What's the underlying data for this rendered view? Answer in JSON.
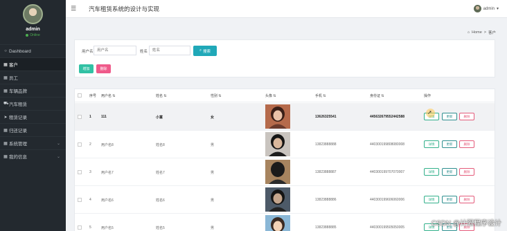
{
  "sidebar": {
    "username": "admin",
    "status": "Online",
    "items": [
      {
        "label": "Dashboard",
        "icon": "circle-icon"
      },
      {
        "label": "客户",
        "icon": "grid-icon",
        "active": true
      },
      {
        "label": "员工",
        "icon": "grid-icon"
      },
      {
        "label": "车辆品牌",
        "icon": "grid-icon"
      },
      {
        "label": "汽车租赁",
        "icon": "car-icon"
      },
      {
        "label": "租赁记录",
        "icon": "paper-plane-icon"
      },
      {
        "label": "归还记录",
        "icon": "grid-icon"
      },
      {
        "label": "系统管理",
        "icon": "grid-icon",
        "chevron": true
      },
      {
        "label": "我的信息",
        "icon": "grid-icon",
        "chevron": true
      }
    ]
  },
  "header": {
    "title": "汽车租赁系统的设计与实现",
    "user": "admin"
  },
  "breadcrumb": {
    "home": "Home",
    "sep": ">",
    "current": "客户"
  },
  "search": {
    "username_label": "用户名",
    "username_placeholder": "用户名",
    "name_label": "姓名",
    "name_placeholder": "姓名",
    "search_button": "搜索"
  },
  "actions": {
    "add": "增加",
    "delete": "删除"
  },
  "table": {
    "columns": [
      "序号",
      "用户名",
      "姓名",
      "性别",
      "头像",
      "手机",
      "身份证",
      "操作"
    ],
    "rows": [
      {
        "index": "1",
        "username": "111",
        "name": "小富",
        "gender": "女",
        "phone": "13626325541",
        "id_card": "445632679552442588",
        "photo": "photo-1"
      },
      {
        "index": "2",
        "username": "用户名8",
        "name": "姓名8",
        "gender": "男",
        "phone": "13823888888",
        "id_card": "440300199808080008",
        "photo": "photo-2"
      },
      {
        "index": "3",
        "username": "用户名7",
        "name": "姓名7",
        "gender": "男",
        "phone": "13823888887",
        "id_card": "440300199707070007",
        "photo": "photo-3"
      },
      {
        "index": "4",
        "username": "用户名6",
        "name": "姓名6",
        "gender": "男",
        "phone": "13823888886",
        "id_card": "440300199606060006",
        "photo": "photo-4"
      },
      {
        "index": "5",
        "username": "用户名5",
        "name": "姓名5",
        "gender": "男",
        "phone": "13823888885",
        "id_card": "440300199505050005",
        "photo": "photo-5"
      }
    ],
    "ops": {
      "detail": "详情",
      "edit": "更新",
      "remove": "删除"
    }
  },
  "watermark": "CSDN @计限程序设计"
}
